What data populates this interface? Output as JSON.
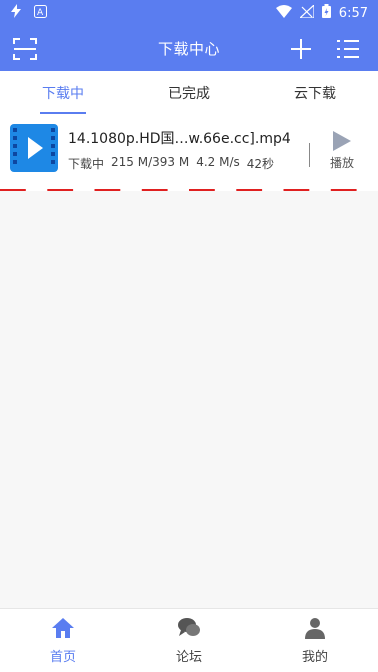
{
  "status_bar": {
    "time": "6:57",
    "icons": [
      "flash-icon",
      "a-icon",
      "wifi-icon",
      "signal-icon",
      "battery-icon"
    ]
  },
  "app_bar": {
    "title": "下载中心",
    "icons": [
      "scan-icon",
      "add-icon",
      "list-menu-icon"
    ]
  },
  "tabs": [
    {
      "label": "下载中",
      "active": true
    },
    {
      "label": "已完成",
      "active": false
    },
    {
      "label": "云下载",
      "active": false
    }
  ],
  "download_item": {
    "file_name": "14.1080p.HD国…w.66e.cc].mp4",
    "status": "下载中",
    "progress_text": "215 M/393 M",
    "speed": "4.2 M/s",
    "time_left": "42秒",
    "progress_fraction": 0.547,
    "play_label": "播放"
  },
  "bottom_nav": [
    {
      "label": "首页",
      "icon": "home-icon",
      "active": true
    },
    {
      "label": "论坛",
      "icon": "forum-icon",
      "active": false
    },
    {
      "label": "我的",
      "icon": "profile-icon",
      "active": false
    }
  ],
  "colors": {
    "primary": "#5a7df0",
    "progress": "#e02020",
    "video_icon": "#1e88e5"
  }
}
